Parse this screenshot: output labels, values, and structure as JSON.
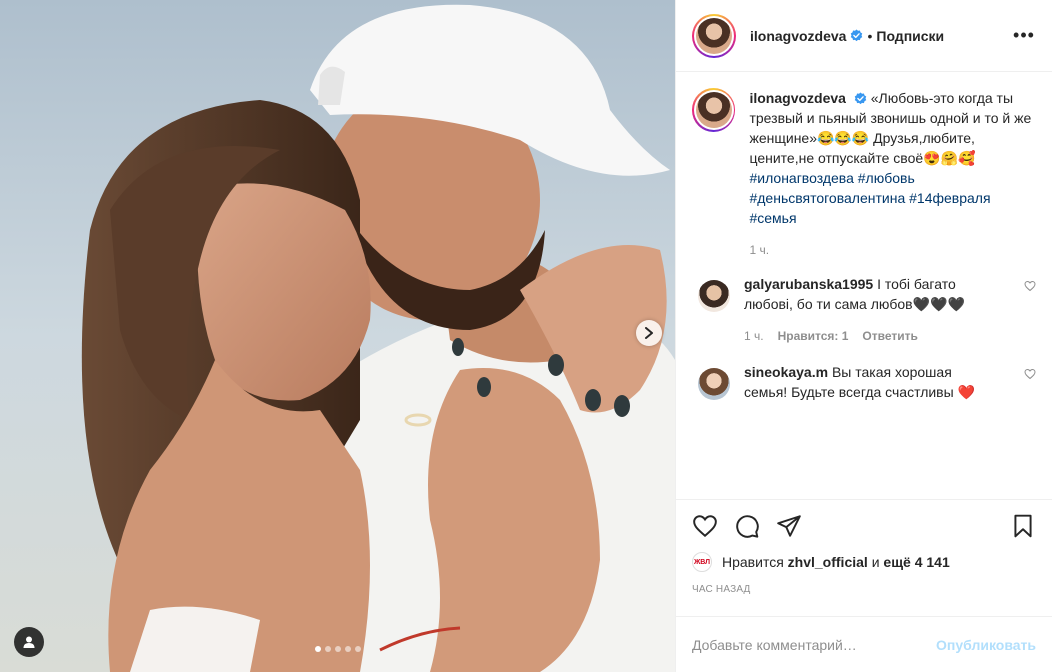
{
  "post": {
    "author": "ilonagvozdeva",
    "follow_status": "Подписки",
    "more_glyph": "•••",
    "caption_text_1": "«Любовь-это когда ты трезвый и пьяный звонишь одной и то й же женщине»😂😂😂 Друзья,любите, цените,не отпускайте своё😍🤗🥰",
    "hashtags": [
      "#илонагвоздева",
      "#любовь",
      "#деньсвятоговалентина",
      "#14февраля",
      "#семья"
    ],
    "caption_time": "1 ч."
  },
  "comments": [
    {
      "user": "galyarubanska1995",
      "text": "І тобі багато любові, бо ти сама любов🖤🖤🖤",
      "time": "1 ч.",
      "likes": "Нравится: 1",
      "reply": "Ответить"
    },
    {
      "user": "sineokaya.m",
      "text": "Вы такая хорошая семья! Будьте всегда счастливы ❤️"
    }
  ],
  "likes": {
    "prefix": "Нравится",
    "user": "zhvl_official",
    "conj": "и",
    "rest": "ещё 4 141",
    "mini_avatar": "ЖВЛ"
  },
  "timestamp": "ЧАС НАЗАД",
  "add_comment": {
    "placeholder": "Добавьте комментарий…",
    "publish": "Опубликовать"
  },
  "carousel": {
    "slides": 5,
    "active": 1
  },
  "colors": {
    "verified": "#3897f0",
    "link": "#00376b",
    "publish_disabled": "#b2dffc",
    "muted": "#8e8e8e"
  },
  "icons": [
    "heart-icon",
    "comment-icon",
    "share-icon",
    "bookmark-icon",
    "chevron-right-icon",
    "user-tag-icon",
    "more-icon",
    "verified-icon"
  ]
}
